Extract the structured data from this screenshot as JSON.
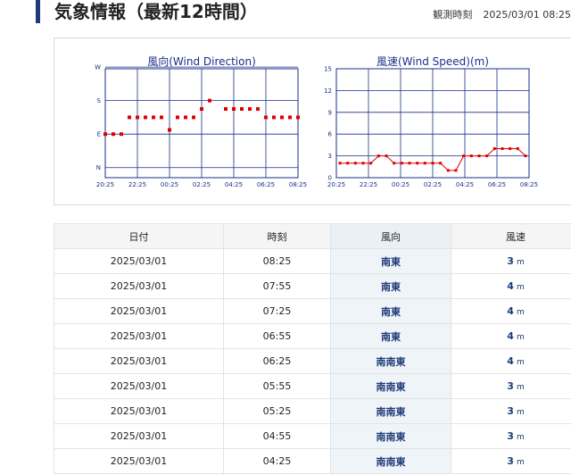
{
  "header": {
    "title": "気象情報（最新12時間）",
    "obs_label": "観測時刻",
    "obs_value": "2025/03/01 08:25"
  },
  "colors": {
    "accent": "#1e3a78",
    "chart_line": "#e00000",
    "chart_grid": "#1a2f8a"
  },
  "chart_data": [
    {
      "type": "scatter",
      "title": "風向(Wind Direction)",
      "x": [
        "20:25",
        "20:55",
        "21:25",
        "21:55",
        "22:25",
        "22:55",
        "23:25",
        "23:55",
        "00:25",
        "00:55",
        "01:25",
        "01:55",
        "02:25",
        "02:55",
        "03:25",
        "03:55",
        "04:25",
        "04:55",
        "05:25",
        "05:55",
        "06:25",
        "06:55",
        "07:25",
        "07:55",
        "08:25"
      ],
      "x_tick_labels": [
        "20:25",
        "22:25",
        "00:25",
        "02:25",
        "04:25",
        "06:25",
        "08:25"
      ],
      "y_tick_labels": [
        "W",
        "S",
        "E",
        "N"
      ],
      "y_scale": [
        "N",
        "NNE",
        "NE",
        "ENE",
        "E",
        "ESE",
        "SE",
        "SSE",
        "S",
        "SSW",
        "SW",
        "WSW",
        "W"
      ],
      "y_indices": [
        4,
        4,
        4,
        6,
        6,
        6,
        6,
        6,
        4.5,
        6,
        6,
        6,
        7,
        8,
        null,
        7,
        7,
        7,
        7,
        7,
        6,
        6,
        6,
        6,
        6
      ],
      "grid": true
    },
    {
      "type": "line",
      "title": "風速(Wind Speed)(m)",
      "x": [
        "20:25",
        "20:55",
        "21:25",
        "21:55",
        "22:25",
        "22:55",
        "23:25",
        "23:55",
        "00:25",
        "00:55",
        "01:25",
        "01:55",
        "02:25",
        "02:55",
        "03:25",
        "03:55",
        "04:25",
        "04:55",
        "05:25",
        "05:55",
        "06:25",
        "06:55",
        "07:25",
        "07:55",
        "08:25"
      ],
      "x_tick_labels": [
        "20:25",
        "22:25",
        "00:25",
        "02:25",
        "04:25",
        "06:25",
        "08:25"
      ],
      "y_tick_labels": [
        "0",
        "3",
        "6",
        "9",
        "12",
        "15"
      ],
      "ylim": [
        0,
        15
      ],
      "values": [
        2,
        2,
        2,
        2,
        2,
        3,
        3,
        2,
        2,
        2,
        2,
        2,
        2,
        2,
        1,
        1,
        3,
        3,
        3,
        3,
        4,
        4,
        4,
        4,
        3
      ],
      "grid": true
    }
  ],
  "table": {
    "headers": [
      "日付",
      "時刻",
      "風向",
      "風速"
    ],
    "unit": "m",
    "rows": [
      {
        "date": "2025/03/01",
        "time": "08:25",
        "dir": "南東",
        "speed": "3"
      },
      {
        "date": "2025/03/01",
        "time": "07:55",
        "dir": "南東",
        "speed": "4"
      },
      {
        "date": "2025/03/01",
        "time": "07:25",
        "dir": "南東",
        "speed": "4"
      },
      {
        "date": "2025/03/01",
        "time": "06:55",
        "dir": "南東",
        "speed": "4"
      },
      {
        "date": "2025/03/01",
        "time": "06:25",
        "dir": "南南東",
        "speed": "4"
      },
      {
        "date": "2025/03/01",
        "time": "05:55",
        "dir": "南南東",
        "speed": "3"
      },
      {
        "date": "2025/03/01",
        "time": "05:25",
        "dir": "南南東",
        "speed": "3"
      },
      {
        "date": "2025/03/01",
        "time": "04:55",
        "dir": "南南東",
        "speed": "3"
      },
      {
        "date": "2025/03/01",
        "time": "04:25",
        "dir": "南南東",
        "speed": "3"
      }
    ]
  }
}
